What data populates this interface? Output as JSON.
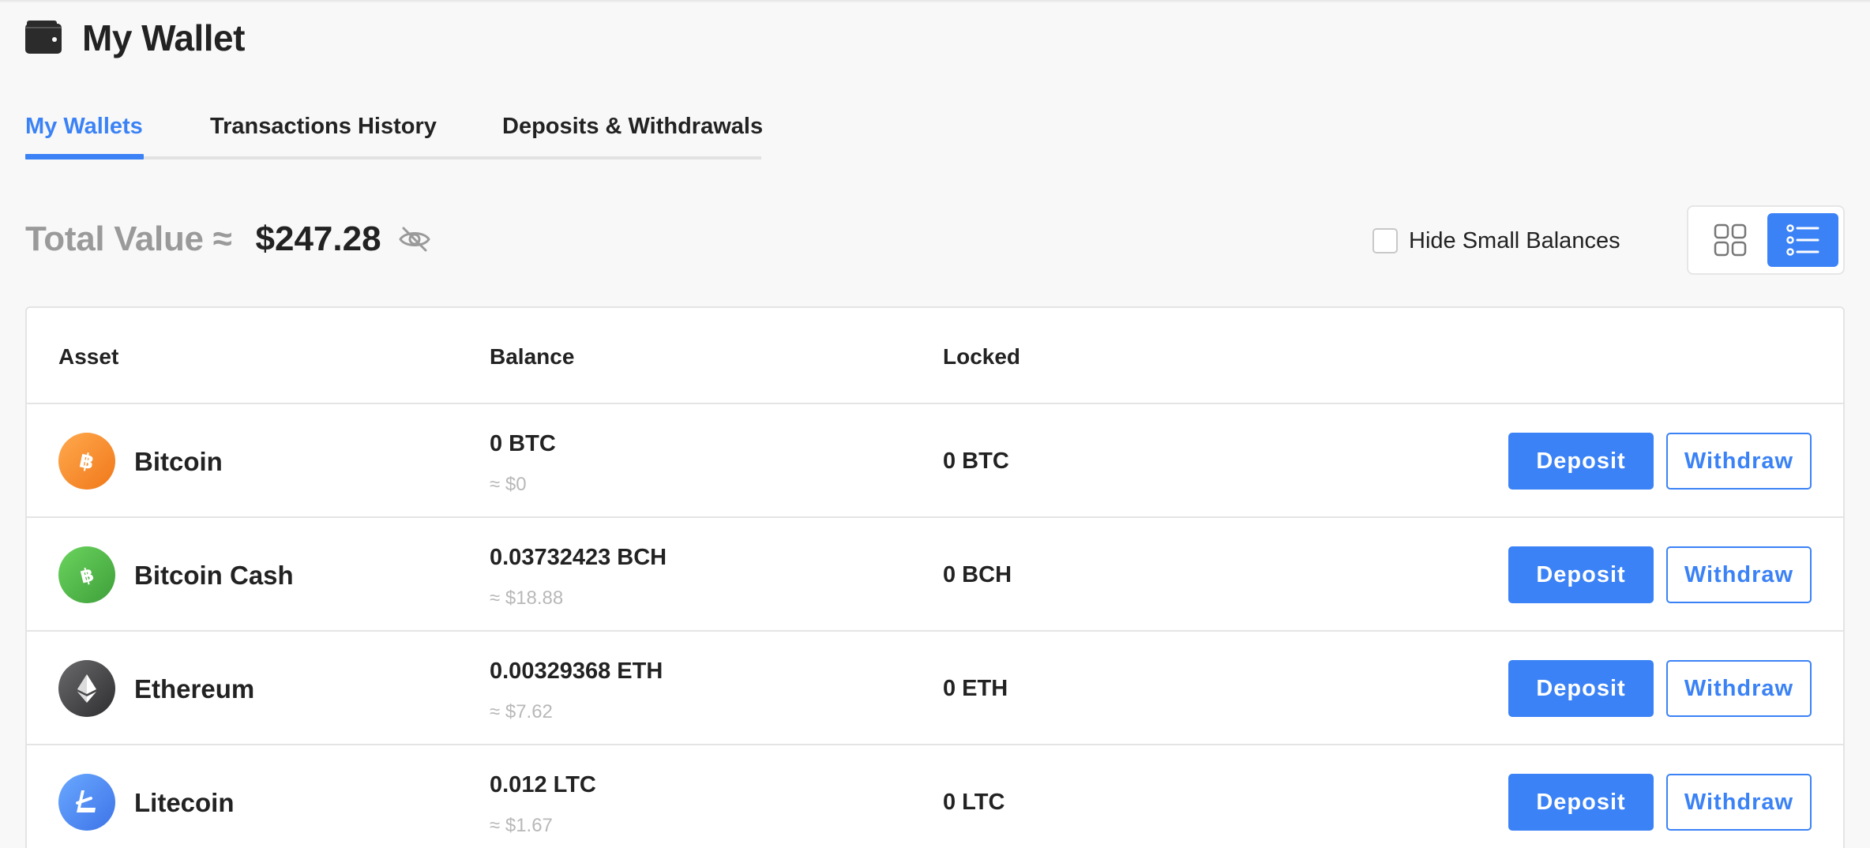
{
  "header": {
    "title": "My Wallet",
    "icon": "wallet-icon"
  },
  "tabs": [
    {
      "label": "My Wallets",
      "active": true
    },
    {
      "label": "Transactions History",
      "active": false
    },
    {
      "label": "Deposits & Withdrawals",
      "active": false
    }
  ],
  "summary": {
    "total_label": "Total Value ≈",
    "total_value": "$247.28",
    "visibility_icon": "eye-slash-icon"
  },
  "filters": {
    "hide_small_label": "Hide Small Balances",
    "hide_small_checked": false
  },
  "view_toggle": {
    "grid_icon": "grid-view-icon",
    "list_icon": "list-view-icon",
    "active": "list"
  },
  "table": {
    "columns": [
      "Asset",
      "Balance",
      "Locked"
    ],
    "rows": [
      {
        "name": "Bitcoin",
        "balance": "0 BTC",
        "usd": "≈ $0",
        "locked": "0 BTC",
        "deposit": "Deposit",
        "withdraw": "Withdraw",
        "icon": "bitcoin-icon"
      },
      {
        "name": "Bitcoin Cash",
        "balance": "0.03732423 BCH",
        "usd": "≈ $18.88",
        "locked": "0 BCH",
        "deposit": "Deposit",
        "withdraw": "Withdraw",
        "icon": "bitcoin-cash-icon"
      },
      {
        "name": "Ethereum",
        "balance": "0.00329368 ETH",
        "usd": "≈ $7.62",
        "locked": "0 ETH",
        "deposit": "Deposit",
        "withdraw": "Withdraw",
        "icon": "ethereum-icon"
      },
      {
        "name": "Litecoin",
        "balance": "0.012 LTC",
        "usd": "≈ $1.67",
        "locked": "0 LTC",
        "deposit": "Deposit",
        "withdraw": "Withdraw",
        "icon": "litecoin-icon"
      }
    ]
  },
  "colors": {
    "accent": "#3b82f6",
    "bitcoin": "#f7931a",
    "bitcoin_cash": "#4cb944",
    "ethereum": "#3c3c3d",
    "litecoin": "#4f8ef7"
  }
}
